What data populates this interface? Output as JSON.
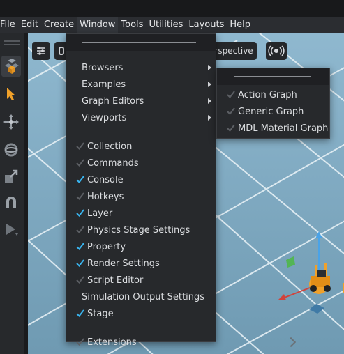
{
  "menubar": {
    "items": [
      "File",
      "Edit",
      "Create",
      "Window",
      "Tools",
      "Utilities",
      "Layouts",
      "Help"
    ],
    "active_item": "Window"
  },
  "viewport": {
    "camera_label": "Perspective",
    "camera_label_visible": "erspective",
    "sky_color": "#8fb4c9",
    "grid_line_color": "#e8f1f6",
    "ground_shadow_color": "#2d3a44"
  },
  "window_menu": {
    "submenus": [
      {
        "label": "Browsers",
        "has_submenu": true
      },
      {
        "label": "Examples",
        "has_submenu": true
      },
      {
        "label": "Graph Editors",
        "has_submenu": true
      },
      {
        "label": "Viewports",
        "has_submenu": true
      }
    ],
    "panels": [
      {
        "label": "Collection",
        "checked": false,
        "has_check": true
      },
      {
        "label": "Commands",
        "checked": false,
        "has_check": true
      },
      {
        "label": "Console",
        "checked": true,
        "has_check": true
      },
      {
        "label": "Hotkeys",
        "checked": false,
        "has_check": true
      },
      {
        "label": "Layer",
        "checked": true,
        "has_check": true
      },
      {
        "label": "Physics Stage Settings",
        "checked": false,
        "has_check": true
      },
      {
        "label": "Property",
        "checked": true,
        "has_check": true
      },
      {
        "label": "Render Settings",
        "checked": true,
        "has_check": true
      },
      {
        "label": "Script Editor",
        "checked": false,
        "has_check": true
      },
      {
        "label": "Simulation Output Settings",
        "checked": false,
        "has_check": false
      },
      {
        "label": "Stage",
        "checked": true,
        "has_check": true
      }
    ],
    "footer": [
      {
        "label": "Extensions",
        "checked": false,
        "has_check": true
      }
    ]
  },
  "graph_editors_submenu": {
    "items": [
      {
        "label": "Action Graph",
        "checked": false
      },
      {
        "label": "Generic Graph",
        "checked": false
      },
      {
        "label": "MDL Material Graph",
        "checked": false
      }
    ]
  },
  "colors": {
    "accent_check": "#39b5f0",
    "dim_check": "#5c5f64",
    "selection_orange": "#f0a12a",
    "axis_red": "#d2433c",
    "axis_green": "#4fb74a",
    "axis_blue": "#4aa3e8"
  },
  "icons": {
    "left_toolbar": [
      "grip-icon",
      "select-mode-icon",
      "select-arrow-icon",
      "move-icon",
      "rotate-icon",
      "scale-icon",
      "snap-magnet-icon",
      "play-icon"
    ],
    "viewport_toolbar": [
      "settings-sliders-icon",
      "camera-partial-icon",
      "audio-waves-icon"
    ]
  }
}
